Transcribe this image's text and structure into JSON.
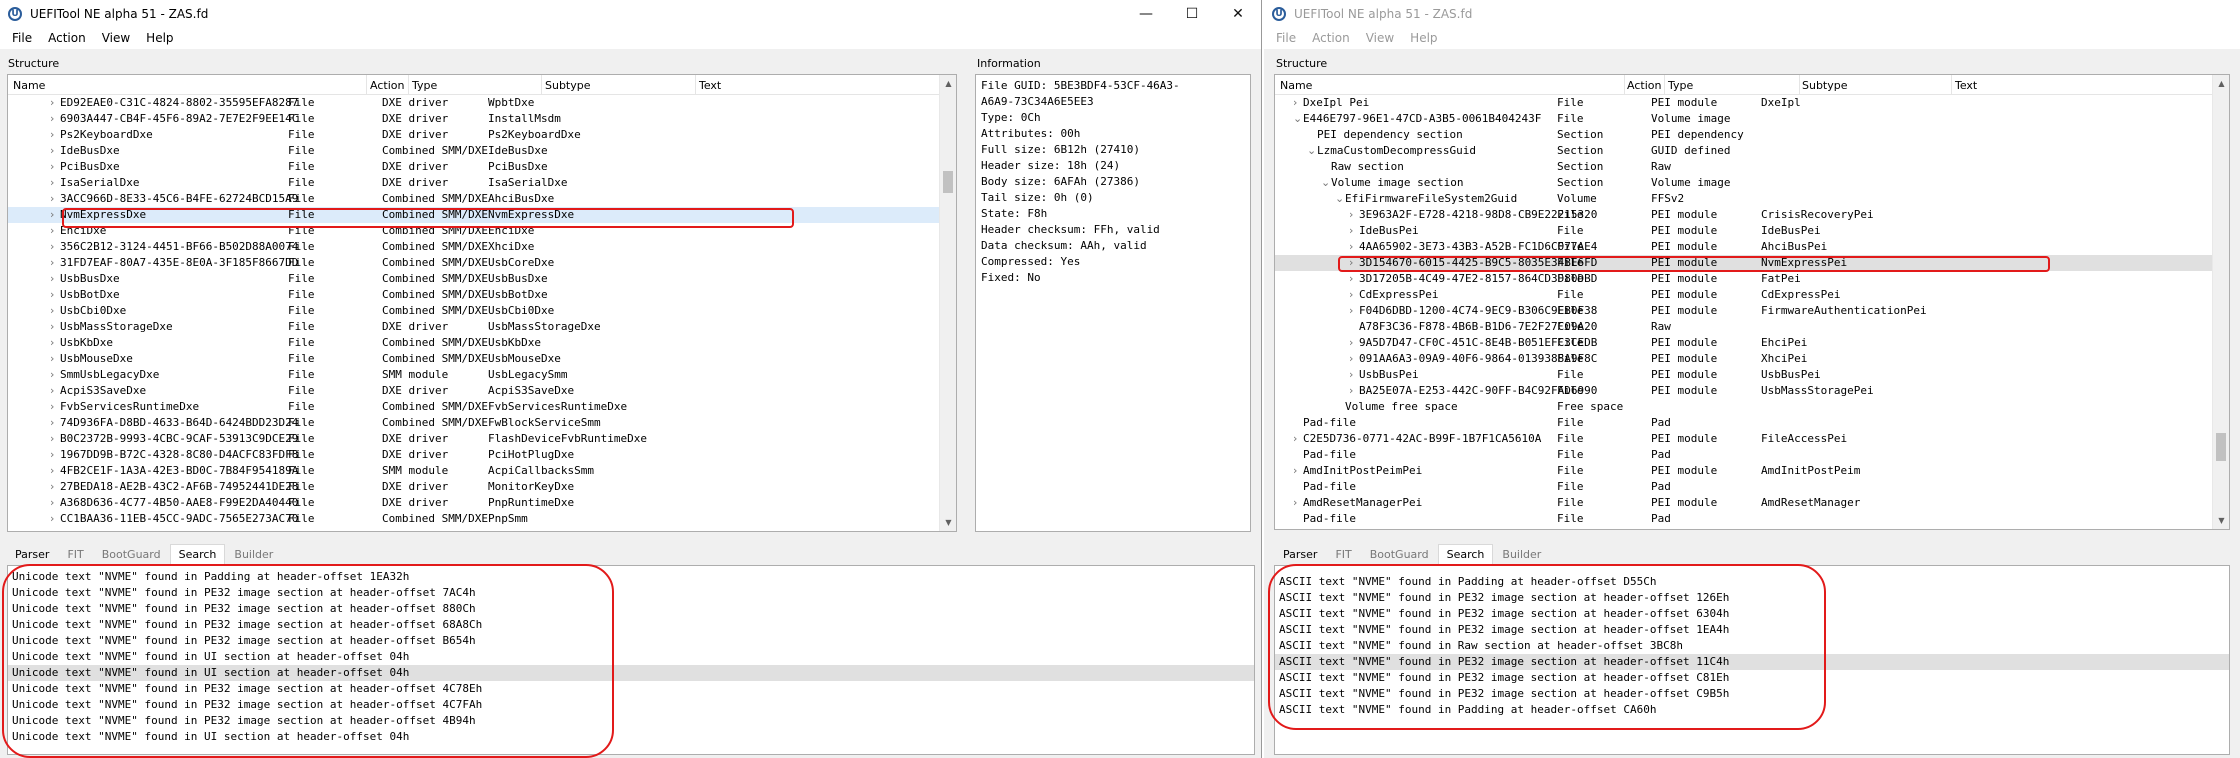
{
  "left": {
    "title": "UEFITool NE alpha 51 - ZAS.fd",
    "menu": [
      "File",
      "Action",
      "View",
      "Help"
    ],
    "structure_label": "Structure",
    "information_label": "Information",
    "columns": [
      "Name",
      "Action",
      "Type",
      "Subtype",
      "Text"
    ],
    "rows": [
      {
        "name": "ED92EAE0-C31C-4824-8802-35595EFA8287",
        "type": "File",
        "subtype": "DXE driver",
        "text": "WpbtDxe"
      },
      {
        "name": "6903A447-CB4F-45F6-89A2-7E7E2F9EE14C",
        "type": "File",
        "subtype": "DXE driver",
        "text": "InstallMsdm"
      },
      {
        "name": "Ps2KeyboardDxe",
        "type": "File",
        "subtype": "DXE driver",
        "text": "Ps2KeyboardDxe"
      },
      {
        "name": "IdeBusDxe",
        "type": "File",
        "subtype": "Combined SMM/DXE",
        "text": "IdeBusDxe"
      },
      {
        "name": "PciBusDxe",
        "type": "File",
        "subtype": "DXE driver",
        "text": "PciBusDxe"
      },
      {
        "name": "IsaSerialDxe",
        "type": "File",
        "subtype": "DXE driver",
        "text": "IsaSerialDxe"
      },
      {
        "name": "3ACC966D-8E33-45C6-B4FE-62724BCD15A9",
        "type": "File",
        "subtype": "Combined SMM/DXE",
        "text": "AhciBusDxe"
      },
      {
        "name": "NvmExpressDxe",
        "type": "File",
        "subtype": "Combined SMM/DXE",
        "text": "NvmExpressDxe"
      },
      {
        "name": "EhciDxe",
        "type": "File",
        "subtype": "Combined SMM/DXE",
        "text": "EhciDxe"
      },
      {
        "name": "356C2B12-3124-4451-BF66-B502D88A0074",
        "type": "File",
        "subtype": "Combined SMM/DXE",
        "text": "XhciDxe"
      },
      {
        "name": "31FD7EAF-80A7-435E-8E0A-3F185F8667DD",
        "type": "File",
        "subtype": "Combined SMM/DXE",
        "text": "UsbCoreDxe"
      },
      {
        "name": "UsbBusDxe",
        "type": "File",
        "subtype": "Combined SMM/DXE",
        "text": "UsbBusDxe"
      },
      {
        "name": "UsbBotDxe",
        "type": "File",
        "subtype": "Combined SMM/DXE",
        "text": "UsbBotDxe"
      },
      {
        "name": "UsbCbi0Dxe",
        "type": "File",
        "subtype": "Combined SMM/DXE",
        "text": "UsbCbi0Dxe"
      },
      {
        "name": "UsbMassStorageDxe",
        "type": "File",
        "subtype": "DXE driver",
        "text": "UsbMassStorageDxe"
      },
      {
        "name": "UsbKbDxe",
        "type": "File",
        "subtype": "Combined SMM/DXE",
        "text": "UsbKbDxe"
      },
      {
        "name": "UsbMouseDxe",
        "type": "File",
        "subtype": "Combined SMM/DXE",
        "text": "UsbMouseDxe"
      },
      {
        "name": "SmmUsbLegacyDxe",
        "type": "File",
        "subtype": "SMM module",
        "text": "UsbLegacySmm"
      },
      {
        "name": "AcpiS3SaveDxe",
        "type": "File",
        "subtype": "DXE driver",
        "text": "AcpiS3SaveDxe"
      },
      {
        "name": "FvbServicesRuntimeDxe",
        "type": "File",
        "subtype": "Combined SMM/DXE",
        "text": "FvbServicesRuntimeDxe"
      },
      {
        "name": "74D936FA-D8BD-4633-B64D-6424BDD23D24",
        "type": "File",
        "subtype": "Combined SMM/DXE",
        "text": "FwBlockServiceSmm"
      },
      {
        "name": "B0C2372B-9993-4CBC-9CAF-53913C9DCE29",
        "type": "File",
        "subtype": "DXE driver",
        "text": "FlashDeviceFvbRuntimeDxe"
      },
      {
        "name": "1967DD9B-B72C-4328-8C80-D4ACFC83FDF8",
        "type": "File",
        "subtype": "DXE driver",
        "text": "PciHotPlugDxe"
      },
      {
        "name": "4FB2CE1F-1A3A-42E3-BD0C-7B84F954189A",
        "type": "File",
        "subtype": "SMM module",
        "text": "AcpiCallbacksSmm"
      },
      {
        "name": "27BEDA18-AE2B-43C2-AF6B-74952441DE28",
        "type": "File",
        "subtype": "DXE driver",
        "text": "MonitorKeyDxe"
      },
      {
        "name": "A368D636-4C77-4B50-AAE8-F99E2DA40440",
        "type": "File",
        "subtype": "DXE driver",
        "text": "PnpRuntimeDxe"
      },
      {
        "name": "CC1BAA36-11EB-45CC-9ADC-7565E273AC70",
        "type": "File",
        "subtype": "Combined SMM/DXE",
        "text": "PnpSmm"
      }
    ],
    "info_text": "File GUID: 5BE3BDF4-53CF-46A3-\nA6A9-73C34A6E5EE3\nType: 0Ch\nAttributes: 00h\nFull size: 6B12h (27410)\nHeader size: 18h (24)\nBody size: 6AFAh (27386)\nTail size: 0h (0)\nState: F8h\nHeader checksum: FFh, valid\nData checksum: AAh, valid\nCompressed: Yes\nFixed: No",
    "tabs": [
      "Parser",
      "FIT",
      "BootGuard",
      "Search",
      "Builder"
    ],
    "results": [
      "Unicode text \"NVME\" found in Padding at header-offset 1EA32h",
      "Unicode text \"NVME\" found in PE32 image section at header-offset 7AC4h",
      "Unicode text \"NVME\" found in PE32 image section at header-offset 880Ch",
      "Unicode text \"NVME\" found in PE32 image section at header-offset 68A8Ch",
      "Unicode text \"NVME\" found in PE32 image section at header-offset B654h",
      "Unicode text \"NVME\" found in UI section at header-offset 04h",
      "Unicode text \"NVME\" found in UI section at header-offset 04h",
      "Unicode text \"NVME\" found in PE32 image section at header-offset 4C78Eh",
      "Unicode text \"NVME\" found in PE32 image section at header-offset 4C7FAh",
      "Unicode text \"NVME\" found in PE32 image section at header-offset 4B94h",
      "Unicode text \"NVME\" found in UI section at header-offset 04h"
    ]
  },
  "right": {
    "title": "UEFITool NE alpha 51 - ZAS.fd",
    "menu": [
      "File",
      "Action",
      "View",
      "Help"
    ],
    "structure_label": "Structure",
    "columns": [
      "Name",
      "Action",
      "Type",
      "Subtype",
      "Text"
    ],
    "rows": [
      {
        "exp": "›",
        "name": "DxeIpl Pei",
        "type": "File",
        "subtype": "PEI module",
        "text": "DxeIpl"
      },
      {
        "exp": "⌄",
        "name": "E446E797-96E1-47CD-A3B5-0061B404243F",
        "type": "File",
        "subtype": "Volume image",
        "text": ""
      },
      {
        "exp": "",
        "name": "PEI dependency section",
        "type": "Section",
        "subtype": "PEI dependency",
        "text": ""
      },
      {
        "exp": "⌄",
        "name": "LzmaCustomDecompressGuid",
        "type": "Section",
        "subtype": "GUID defined",
        "text": ""
      },
      {
        "exp": "",
        "name": "Raw section",
        "type": "Section",
        "subtype": "Raw",
        "text": ""
      },
      {
        "exp": "⌄",
        "name": "Volume image section",
        "type": "Section",
        "subtype": "Volume image",
        "text": ""
      },
      {
        "exp": "⌄",
        "name": "EfiFirmwareFileSystem2Guid",
        "type": "Volume",
        "subtype": "FFSv2",
        "text": ""
      },
      {
        "exp": "›",
        "name": "3E963A2F-E728-4218-98D8-CB9E22215320",
        "type": "File",
        "subtype": "PEI module",
        "text": "CrisisRecoveryPei"
      },
      {
        "exp": "›",
        "name": "IdeBusPei",
        "type": "File",
        "subtype": "PEI module",
        "text": "IdeBusPei"
      },
      {
        "exp": "›",
        "name": "4AA65902-3E73-43B3-A52B-FC1D6C077AE4",
        "type": "File",
        "subtype": "PEI module",
        "text": "AhciBusPei"
      },
      {
        "exp": "›",
        "name": "3D154670-6015-4425-B9C5-8035E34BE6FD",
        "type": "File",
        "subtype": "PEI module",
        "text": "NvmExpressPei"
      },
      {
        "exp": "›",
        "name": "3D17205B-4C49-47E2-8157-864CD3D80DBD",
        "type": "File",
        "subtype": "PEI module",
        "text": "FatPei"
      },
      {
        "exp": "›",
        "name": "CdExpressPei",
        "type": "File",
        "subtype": "PEI module",
        "text": "CdExpressPei"
      },
      {
        "exp": "›",
        "name": "F04D6DBD-1200-4C74-9EC9-B306C9EB0F38",
        "type": "File",
        "subtype": "PEI module",
        "text": "FirmwareAuthenticationPei"
      },
      {
        "exp": "",
        "name": "A78F3C36-F878-4B6B-B1D6-7E2F27C09A20",
        "type": "File",
        "subtype": "Raw",
        "text": ""
      },
      {
        "exp": "›",
        "name": "9A5D7D47-CF0C-451C-8E4B-B051EFC3CEDB",
        "type": "File",
        "subtype": "PEI module",
        "text": "EhciPei"
      },
      {
        "exp": "›",
        "name": "091AA6A3-09A9-40F6-9864-0139388A9F8C",
        "type": "File",
        "subtype": "PEI module",
        "text": "XhciPei"
      },
      {
        "exp": "›",
        "name": "UsbBusPei",
        "type": "File",
        "subtype": "PEI module",
        "text": "UsbBusPei"
      },
      {
        "exp": "›",
        "name": "BA25E07A-E253-442C-90FF-B4C92FAD6990",
        "type": "File",
        "subtype": "PEI module",
        "text": "UsbMassStoragePei"
      },
      {
        "exp": "",
        "name": "Volume free space",
        "type": "Free space",
        "subtype": "",
        "text": ""
      },
      {
        "exp": "",
        "name": "Pad-file",
        "type": "File",
        "subtype": "Pad",
        "text": ""
      },
      {
        "exp": "›",
        "name": "C2E5D736-0771-42AC-B99F-1B7F1CA5610A",
        "type": "File",
        "subtype": "PEI module",
        "text": "FileAccessPei"
      },
      {
        "exp": "",
        "name": "Pad-file",
        "type": "File",
        "subtype": "Pad",
        "text": ""
      },
      {
        "exp": "›",
        "name": "AmdInitPostPeimPei",
        "type": "File",
        "subtype": "PEI module",
        "text": "AmdInitPostPeim"
      },
      {
        "exp": "",
        "name": "Pad-file",
        "type": "File",
        "subtype": "Pad",
        "text": ""
      },
      {
        "exp": "›",
        "name": "AmdResetManagerPei",
        "type": "File",
        "subtype": "PEI module",
        "text": "AmdResetManager"
      },
      {
        "exp": "",
        "name": "Pad-file",
        "type": "File",
        "subtype": "Pad",
        "text": ""
      }
    ],
    "tabs": [
      "Parser",
      "FIT",
      "BootGuard",
      "Search",
      "Builder"
    ],
    "results": [
      "ASCII text \"NVME\" found in Padding at header-offset D55Ch",
      "ASCII text \"NVME\" found in PE32 image section at header-offset 126Eh",
      "ASCII text \"NVME\" found in PE32 image section at header-offset 6304h",
      "ASCII text \"NVME\" found in PE32 image section at header-offset 1EA4h",
      "ASCII text \"NVME\" found in Raw section at header-offset 3BC8h",
      "ASCII text \"NVME\" found in PE32 image section at header-offset 11C4h",
      "ASCII text \"NVME\" found in PE32 image section at header-offset C81Eh",
      "ASCII text \"NVME\" found in PE32 image section at header-offset C9B5h",
      "ASCII text \"NVME\" found in Padding at header-offset CA60h"
    ]
  },
  "colors": {
    "highlight_outline": "#e21a1a",
    "selection": "#dcebfa"
  }
}
